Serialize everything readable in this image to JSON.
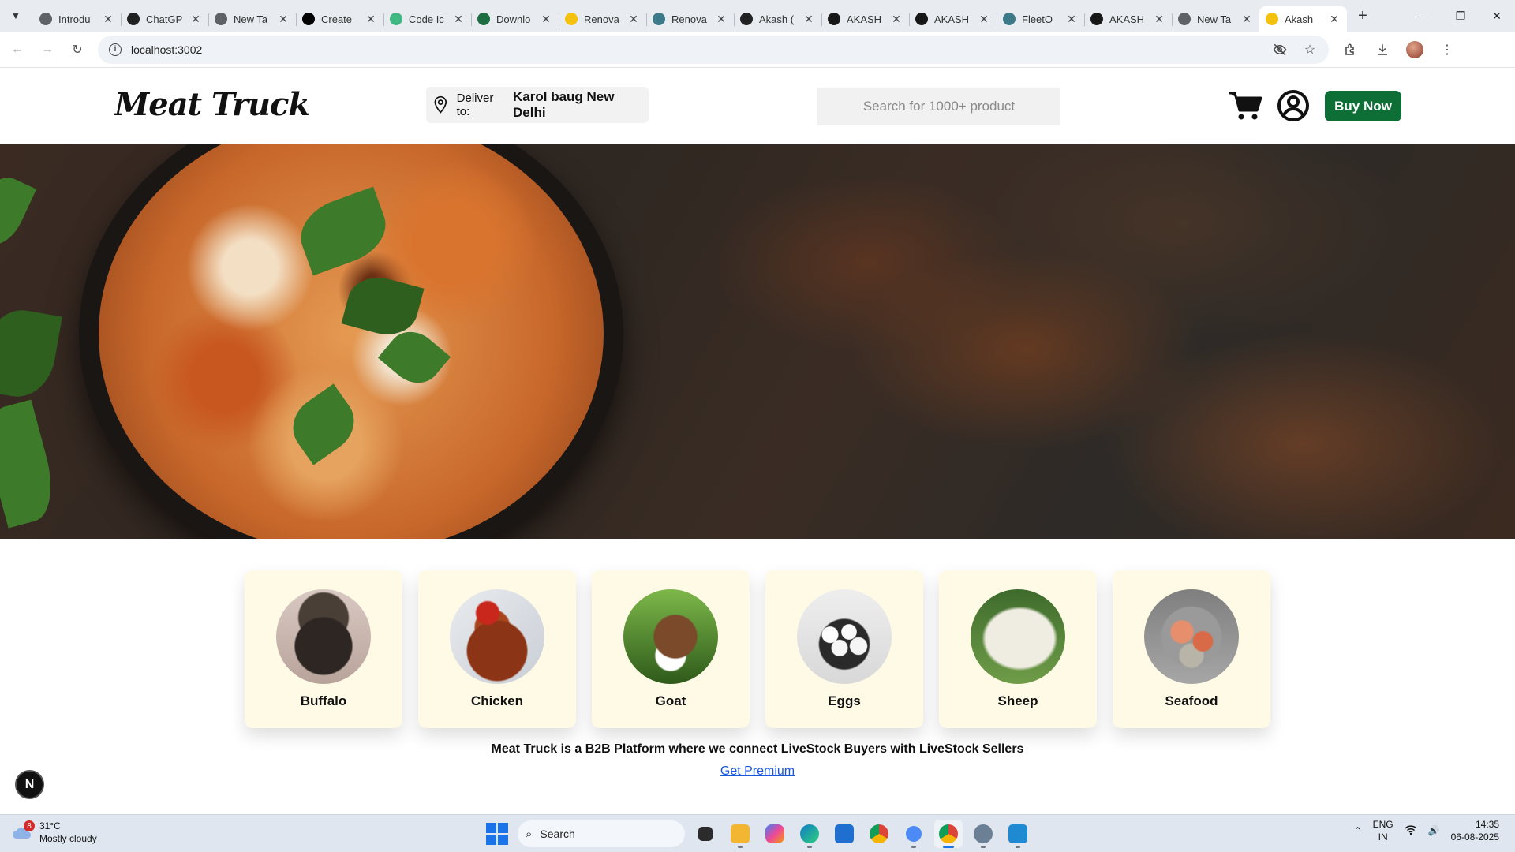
{
  "browser": {
    "tabs": [
      {
        "title": "Introdu",
        "favicon_color": "#5f6368",
        "active": false
      },
      {
        "title": "ChatGP",
        "favicon_color": "#202123",
        "active": false
      },
      {
        "title": "New Ta",
        "favicon_color": "#5f6368",
        "active": false
      },
      {
        "title": "Create",
        "favicon_color": "#000000",
        "active": false
      },
      {
        "title": "Code Ic",
        "favicon_color": "#41b883",
        "active": false
      },
      {
        "title": "Downlo",
        "favicon_color": "#1d6f42",
        "active": false
      },
      {
        "title": "Renova",
        "favicon_color": "#f4c20d",
        "active": false
      },
      {
        "title": "Renova",
        "favicon_color": "#3c7a89",
        "active": false
      },
      {
        "title": "Akash (",
        "favicon_color": "#222222",
        "active": false
      },
      {
        "title": "AKASH",
        "favicon_color": "#181717",
        "active": false
      },
      {
        "title": "AKASH",
        "favicon_color": "#181717",
        "active": false
      },
      {
        "title": "FleetO",
        "favicon_color": "#3c7a89",
        "active": false
      },
      {
        "title": "AKASH",
        "favicon_color": "#181717",
        "active": false
      },
      {
        "title": "New Ta",
        "favicon_color": "#5f6368",
        "active": false
      },
      {
        "title": "Akash",
        "favicon_color": "#f4c20d",
        "active": true
      }
    ],
    "url": "localhost:3002"
  },
  "header": {
    "logo": "Meat Truck",
    "deliver_label": "Deliver to:",
    "deliver_location": "Karol baug New Delhi",
    "search_placeholder": "Search for 1000+ product",
    "buy_button": "Buy Now"
  },
  "categories": [
    {
      "label": "Buffalo",
      "icon": "buffalo-image"
    },
    {
      "label": "Chicken",
      "icon": "chicken-image"
    },
    {
      "label": "Goat",
      "icon": "goat-image"
    },
    {
      "label": "Eggs",
      "icon": "eggs-image"
    },
    {
      "label": "Sheep",
      "icon": "sheep-image"
    },
    {
      "label": "Seafood",
      "icon": "seafood-image"
    }
  ],
  "footer": {
    "tagline": "Meat Truck is a B2B Platform where we connect LiveStock Buyers with LiveStock Sellers",
    "premium_link": "Get Premium",
    "badge": "N"
  },
  "taskbar": {
    "weather_badge": "8",
    "temperature": "31°C",
    "condition": "Mostly cloudy",
    "search_label": "Search",
    "lang_line1": "ENG",
    "lang_line2": "IN",
    "time": "14:35",
    "date": "06-08-2025"
  },
  "colors": {
    "buy_button": "#0d6e36",
    "category_card": "#fefae6",
    "link": "#1a56d9"
  }
}
